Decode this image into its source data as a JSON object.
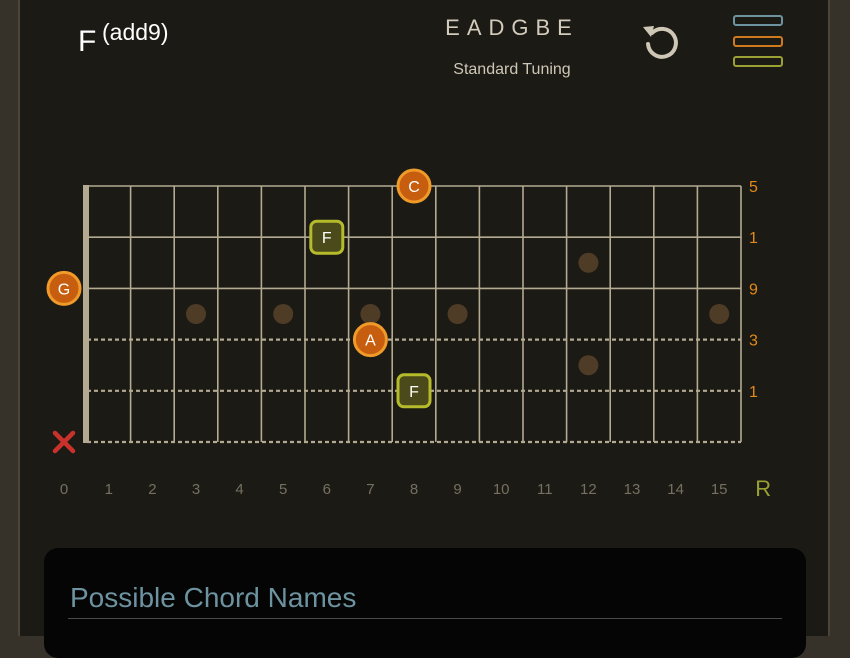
{
  "chord": {
    "root": "F",
    "extension": "(add9)"
  },
  "tuning": {
    "strings": "EADGBE",
    "name": "Standard Tuning"
  },
  "toolbar": {
    "reset_icon": "reset-icon",
    "layers_icon": "layers-icon"
  },
  "colors": {
    "background": "#1b1a15",
    "frame": "#363129",
    "fret_line": "#b3aa91",
    "root_fill": "#4a4a1a",
    "root_border": "#b5bb2a",
    "note_fill": "#c75e0f",
    "note_border": "#f09a2a",
    "interval_text": "#e28a18",
    "fret_number_text": "#777060",
    "panel_title": "#6d93a0",
    "mute_x": "#c8312c"
  },
  "fret_numbers": [
    "0",
    "1",
    "2",
    "3",
    "4",
    "5",
    "6",
    "7",
    "8",
    "9",
    "10",
    "11",
    "12",
    "13",
    "14",
    "15"
  ],
  "root_label": "R",
  "inlays": [
    {
      "string": 3.5,
      "fret": 3
    },
    {
      "string": 3.5,
      "fret": 5
    },
    {
      "string": 3.5,
      "fret": 7
    },
    {
      "string": 3.5,
      "fret": 9
    },
    {
      "string": 3.5,
      "fret": 15
    },
    {
      "string": 2.5,
      "fret": 12
    },
    {
      "string": 4.5,
      "fret": 12
    }
  ],
  "strings": [
    {
      "index": 1,
      "open": "E",
      "interval": "5",
      "dashed": false
    },
    {
      "index": 2,
      "open": "B",
      "interval": "1",
      "dashed": false
    },
    {
      "index": 3,
      "open": "G",
      "interval": "9",
      "dashed": false
    },
    {
      "index": 4,
      "open": "D",
      "interval": "3",
      "dashed": true
    },
    {
      "index": 5,
      "open": "A",
      "interval": "1",
      "dashed": true
    },
    {
      "index": 6,
      "open": "E",
      "interval": "",
      "dashed": true,
      "muted": true
    }
  ],
  "notes": [
    {
      "string": 1,
      "fret": 8,
      "label": "C",
      "type": "note"
    },
    {
      "string": 2,
      "fret": 6,
      "label": "F",
      "type": "root"
    },
    {
      "string": 3,
      "fret": 0,
      "label": "G",
      "type": "note"
    },
    {
      "string": 4,
      "fret": 7,
      "label": "A",
      "type": "note"
    },
    {
      "string": 5,
      "fret": 8,
      "label": "F",
      "type": "root"
    }
  ],
  "mute_symbol": "✕",
  "chord_names": {
    "title": "Possible Chord Names"
  }
}
